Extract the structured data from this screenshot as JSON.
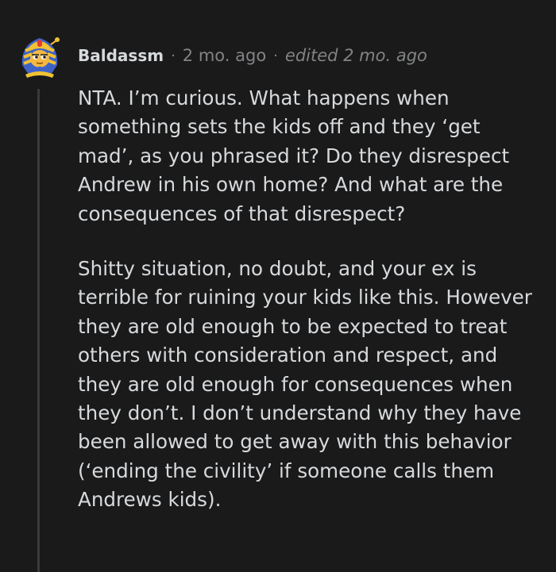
{
  "comment": {
    "author": "Baldassm",
    "separator": "·",
    "posted": "2 mo. ago",
    "edited": "edited 2 mo. ago",
    "paragraphs": [
      "NTA. I’m curious. What happens when something sets the kids off and they ‘get mad’, as you phrased it? Do they disrespect Andrew in his own home? And what are the consequences of that disrespect?",
      "Shitty situation, no doubt, and your ex is terrible for ruining your kids like this. However they are old enough to be expected to treat others with consideration and respect, and they are old enough for consequences when they don’t. I don’t understand why they have been allowed to get away with this behavior (‘ending the civility’ if someone calls them Andrews kids)."
    ],
    "avatar_icon": "pharaoh-snoo-avatar-icon"
  },
  "colors": {
    "background": "#1a1a1b",
    "text": "#d7dadc",
    "meta": "#818384",
    "thread_line": "#3a3a3c"
  }
}
